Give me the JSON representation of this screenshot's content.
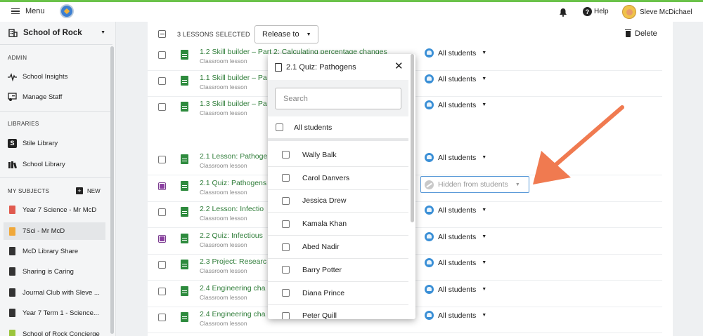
{
  "topbar": {
    "menu_label": "Menu",
    "help_label": "Help",
    "user_name": "Sleve McDichael",
    "accent_color": "#6bc24a"
  },
  "sidebar": {
    "school_name": "School of Rock",
    "sections": {
      "admin": "ADMIN",
      "libraries": "LIBRARIES",
      "my_subjects": "MY SUBJECTS"
    },
    "new_label": "NEW",
    "admin_items": [
      {
        "label": "School Insights",
        "icon": "pulse-icon"
      },
      {
        "label": "Manage Staff",
        "icon": "manage-staff-icon"
      }
    ],
    "library_items": [
      {
        "label": "Stile Library",
        "icon": "stile-logo-icon"
      },
      {
        "label": "School Library",
        "icon": "books-icon"
      }
    ],
    "subjects": [
      {
        "label": "Year 7 Science - Mr McD",
        "color": "#e05a4f",
        "active": false
      },
      {
        "label": "7Sci - Mr McD",
        "color": "#f0a83a",
        "active": true
      },
      {
        "label": "McD Library Share",
        "color": "#333333",
        "active": false
      },
      {
        "label": "Sharing is Caring",
        "color": "#333333",
        "active": false
      },
      {
        "label": "Journal Club with Sleve ...",
        "color": "#333333",
        "active": false
      },
      {
        "label": "Year 7 Term 1 - Science...",
        "color": "#333333",
        "active": false
      },
      {
        "label": "School of Rock Concierge",
        "color": "#9bc53d",
        "active": false
      }
    ]
  },
  "toolbar": {
    "selected_count": "3 LESSONS SELECTED",
    "release_label": "Release to",
    "delete_label": "Delete"
  },
  "lessons": [
    {
      "title": "1.2 Skill builder – Part 2: Calculating percentage changes",
      "subtitle": "Classroom lesson",
      "audience": "All students",
      "checked": false
    },
    {
      "title": "1.1 Skill builder – Pa",
      "subtitle": "Classroom lesson",
      "audience": "All students",
      "checked": false
    },
    {
      "title": "1.3 Skill builder – Pa",
      "subtitle": "Classroom lesson",
      "audience": "All students",
      "checked": false
    },
    {
      "title": "2.1 Lesson: Pathoge",
      "subtitle": "Classroom lesson",
      "audience": "All students",
      "checked": false
    },
    {
      "title": "2.1 Quiz: Pathogens",
      "subtitle": "Classroom lesson",
      "audience": "Hidden from students",
      "checked": true,
      "hidden": true
    },
    {
      "title": "2.2 Lesson: Infectio",
      "subtitle": "Classroom lesson",
      "audience": "All students",
      "checked": false
    },
    {
      "title": "2.2 Quiz: Infectious",
      "subtitle": "Classroom lesson",
      "audience": "All students",
      "checked": true
    },
    {
      "title": "2.3 Project: Researc",
      "subtitle": "Classroom lesson",
      "audience": "All students",
      "checked": false
    },
    {
      "title": "2.4 Engineering cha",
      "subtitle": "Classroom lesson",
      "audience": "All students",
      "checked": false
    },
    {
      "title": "2.4 Engineering cha",
      "subtitle": "Classroom lesson",
      "audience": "All students",
      "checked": false
    }
  ],
  "popup": {
    "title": "2.1 Quiz: Pathogens",
    "search_placeholder": "Search",
    "all_label": "All students",
    "students": [
      "Wally Balk",
      "Carol Danvers",
      "Jessica Drew",
      "Kamala Khan",
      "Abed Nadir",
      "Barry Potter",
      "Diana Prince",
      "Peter Quill"
    ]
  },
  "annotation": {
    "arrow_color": "#f07a50",
    "arrow_target": "hidden-from-students-dropdown"
  }
}
